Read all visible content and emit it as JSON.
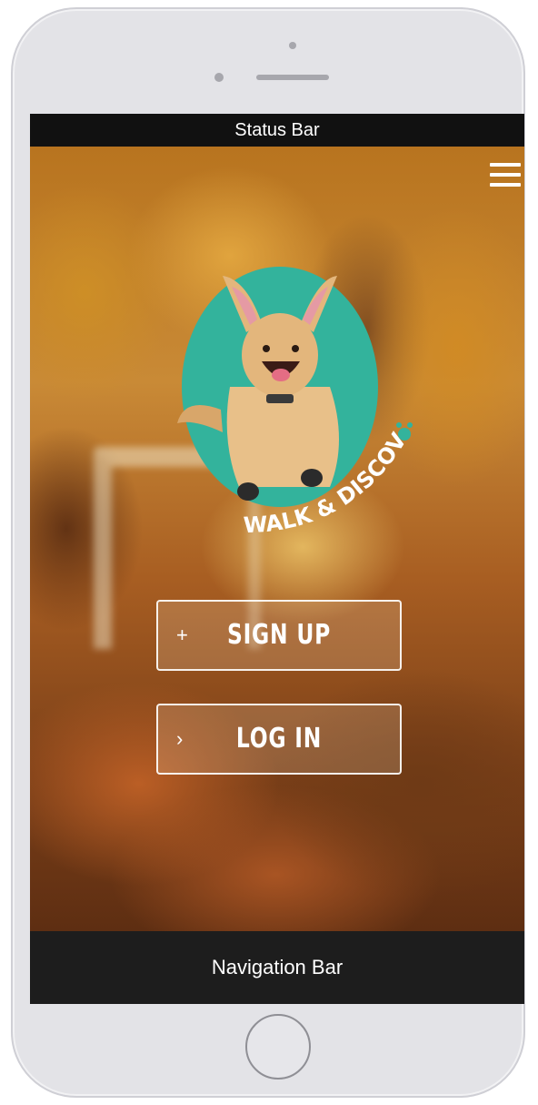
{
  "device": {
    "frame_color": "#e3e3e7"
  },
  "status_bar": {
    "label": "Status Bar"
  },
  "header": {
    "menu_icon": "hamburger-menu-icon"
  },
  "logo": {
    "text": "WALK & DISCOVER",
    "badge_color": "#33b39c"
  },
  "auth": {
    "signup_icon": "+",
    "signup_label": "SIGN UP",
    "login_icon": "›",
    "login_label": "LOG IN"
  },
  "nav_bar": {
    "label": "Navigation Bar"
  }
}
